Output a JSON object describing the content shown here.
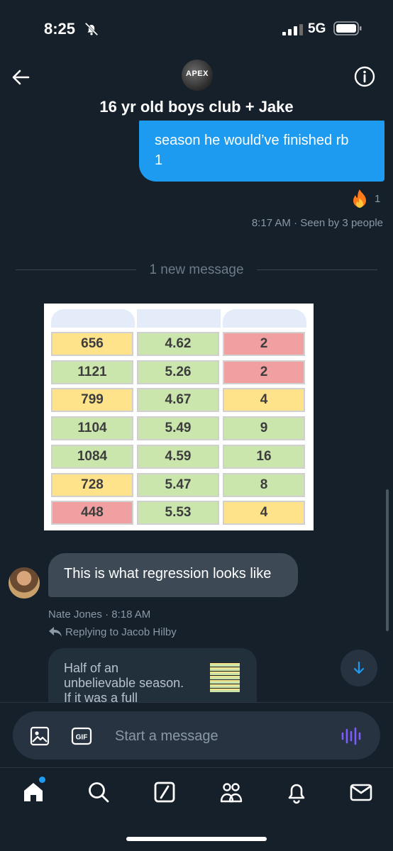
{
  "status": {
    "time": "8:25",
    "network": "5G"
  },
  "header": {
    "avatar_text": "APEX",
    "title": "16 yr old boys club + Jake"
  },
  "sent_message": {
    "lines": [
      "season he would’ve finished rb",
      "1"
    ],
    "reaction_count": "1",
    "time": "8:17 AM",
    "seen": "· Seen by 3 people"
  },
  "divider": {
    "label": "1 new message"
  },
  "image_table": {
    "rows": [
      [
        {
          "v": "656",
          "c": "yellow"
        },
        {
          "v": "4.62",
          "c": "green"
        },
        {
          "v": "2",
          "c": "red"
        }
      ],
      [
        {
          "v": "1121",
          "c": "green"
        },
        {
          "v": "5.26",
          "c": "green"
        },
        {
          "v": "2",
          "c": "red"
        }
      ],
      [
        {
          "v": "799",
          "c": "yellow"
        },
        {
          "v": "4.67",
          "c": "green"
        },
        {
          "v": "4",
          "c": "yellow"
        }
      ],
      [
        {
          "v": "1104",
          "c": "green"
        },
        {
          "v": "5.49",
          "c": "green"
        },
        {
          "v": "9",
          "c": "green"
        }
      ],
      [
        {
          "v": "1084",
          "c": "green"
        },
        {
          "v": "4.59",
          "c": "green"
        },
        {
          "v": "16",
          "c": "green"
        }
      ],
      [
        {
          "v": "728",
          "c": "yellow"
        },
        {
          "v": "5.47",
          "c": "green"
        },
        {
          "v": "8",
          "c": "green"
        }
      ],
      [
        {
          "v": "448",
          "c": "red"
        },
        {
          "v": "5.53",
          "c": "green"
        },
        {
          "v": "4",
          "c": "yellow"
        }
      ]
    ],
    "colors": {
      "yellow": "#ffe38a",
      "green": "#cbe6ad",
      "red": "#f0a0a0"
    }
  },
  "received_message": {
    "text": "This is what regression looks like",
    "sender": "Nate Jones",
    "time": "· 8:18 AM"
  },
  "reply": {
    "label": "Replying to Jacob Hilby",
    "quoted_lines": [
      "Half of an",
      "unbelievable season.",
      "If it was a full"
    ]
  },
  "composer": {
    "placeholder": "Start a message",
    "gif_label": "GIF"
  },
  "tabs": [
    "home-icon",
    "search-icon",
    "grok-icon",
    "communities-icon",
    "notifications-icon",
    "messages-icon"
  ],
  "colors": {
    "background": "#15202b",
    "accent": "#1d9bf0",
    "bubble_received": "#3d4a55",
    "fire": "#ff7a1a"
  }
}
